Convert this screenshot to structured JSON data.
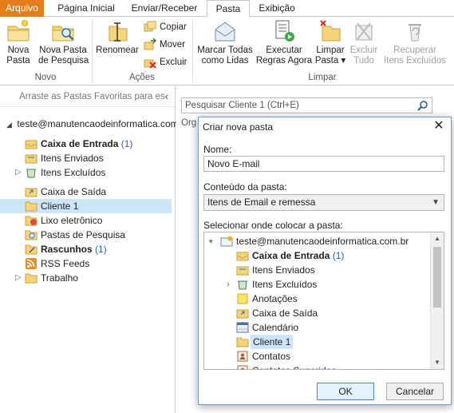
{
  "tabs": [
    {
      "label": "Arquivo"
    },
    {
      "label": "Página Inicial"
    },
    {
      "label": "Enviar/Receber"
    },
    {
      "label": "Pasta"
    },
    {
      "label": "Exibição"
    }
  ],
  "ribbon": {
    "new_group": {
      "label": "Novo",
      "new_folder": "Nova\nPasta",
      "new_search_folder": "Nova Pasta\nde Pesquisa"
    },
    "actions_group": {
      "label": "Ações",
      "rename": "Renomear",
      "copy": "Copiar",
      "move": "Mover",
      "delete": "Excluir"
    },
    "clean_group": {
      "label": "Limpar",
      "mark_all_read": "Marcar Todas\ncomo Lidas",
      "run_rules": "Executar\nRegras Agora",
      "clean_folder": "Limpar\nPasta ▾",
      "delete_all": "Excluir\nTudo",
      "recover_deleted": "Recuperar\nItens Excluídos"
    }
  },
  "folder_pane": {
    "favorites_hint": "Arraste as Pastas Favoritas para es",
    "collapse_chevron": "‹",
    "account": "teste@manutencaodeinformatica.com",
    "folders": [
      {
        "label": "Caixa de Entrada",
        "count": "(1)",
        "bold": true,
        "icon": "inbox-icon"
      },
      {
        "label": "Itens Enviados",
        "count": "",
        "bold": false,
        "icon": "sent-icon"
      },
      {
        "label": "Itens Excluídos",
        "count": "",
        "bold": false,
        "icon": "deleted-icon",
        "expandable": true
      },
      {
        "label": "Caixa de Saída",
        "count": "",
        "bold": false,
        "icon": "outbox-icon"
      },
      {
        "label": "Cliente 1",
        "count": "",
        "bold": false,
        "icon": "folder-icon",
        "selected": true
      },
      {
        "label": "Lixo eletrônico",
        "count": "",
        "bold": false,
        "icon": "junk-icon"
      },
      {
        "label": "Pastas de Pesquisa",
        "count": "",
        "bold": false,
        "icon": "search-folder-icon"
      },
      {
        "label": "Rascunhos",
        "count": "(1)",
        "bold": true,
        "icon": "drafts-icon"
      },
      {
        "label": "RSS Feeds",
        "count": "",
        "bold": false,
        "icon": "rss-icon"
      },
      {
        "label": "Trabalho",
        "count": "",
        "bold": false,
        "icon": "folder-icon",
        "expandable": true
      }
    ]
  },
  "content": {
    "search_placeholder": "Pesquisar Cliente 1 (Ctrl+E)",
    "org_label": "Org"
  },
  "dialog": {
    "title": "Criar nova pasta",
    "name_label": "Nome:",
    "name_value": "Novo E-mail",
    "content_label": "Conteúdo da pasta:",
    "content_value": "Itens de Email e remessa",
    "location_label": "Selecionar onde colocar a pasta:",
    "tree_account": "teste@manutencaodeinformatica.com.br",
    "tree": [
      {
        "label": "Caixa de Entrada",
        "count": "(1)",
        "bold": true,
        "icon": "inbox-icon"
      },
      {
        "label": "Itens Enviados",
        "count": "",
        "bold": false,
        "icon": "sent-icon"
      },
      {
        "label": "Itens Excluídos",
        "count": "",
        "bold": false,
        "icon": "deleted-icon",
        "expandable": true
      },
      {
        "label": "Anotações",
        "count": "",
        "bold": false,
        "icon": "notes-icon"
      },
      {
        "label": "Caixa de Saída",
        "count": "",
        "bold": false,
        "icon": "outbox-icon"
      },
      {
        "label": "Calendário",
        "count": "",
        "bold": false,
        "icon": "calendar-icon"
      },
      {
        "label": "Cliente 1",
        "count": "",
        "bold": false,
        "icon": "folder-icon",
        "selected": true
      },
      {
        "label": "Contatos",
        "count": "",
        "bold": false,
        "icon": "contacts-icon"
      },
      {
        "label": "Contatos Sugeridos",
        "count": "",
        "bold": false,
        "icon": "contacts-icon"
      }
    ],
    "ok_label": "OK",
    "cancel_label": "Cancelar"
  },
  "colors": {
    "file_tab": "#e47e1c",
    "selection": "#cde6f7",
    "count_blue": "#2a62b8"
  }
}
